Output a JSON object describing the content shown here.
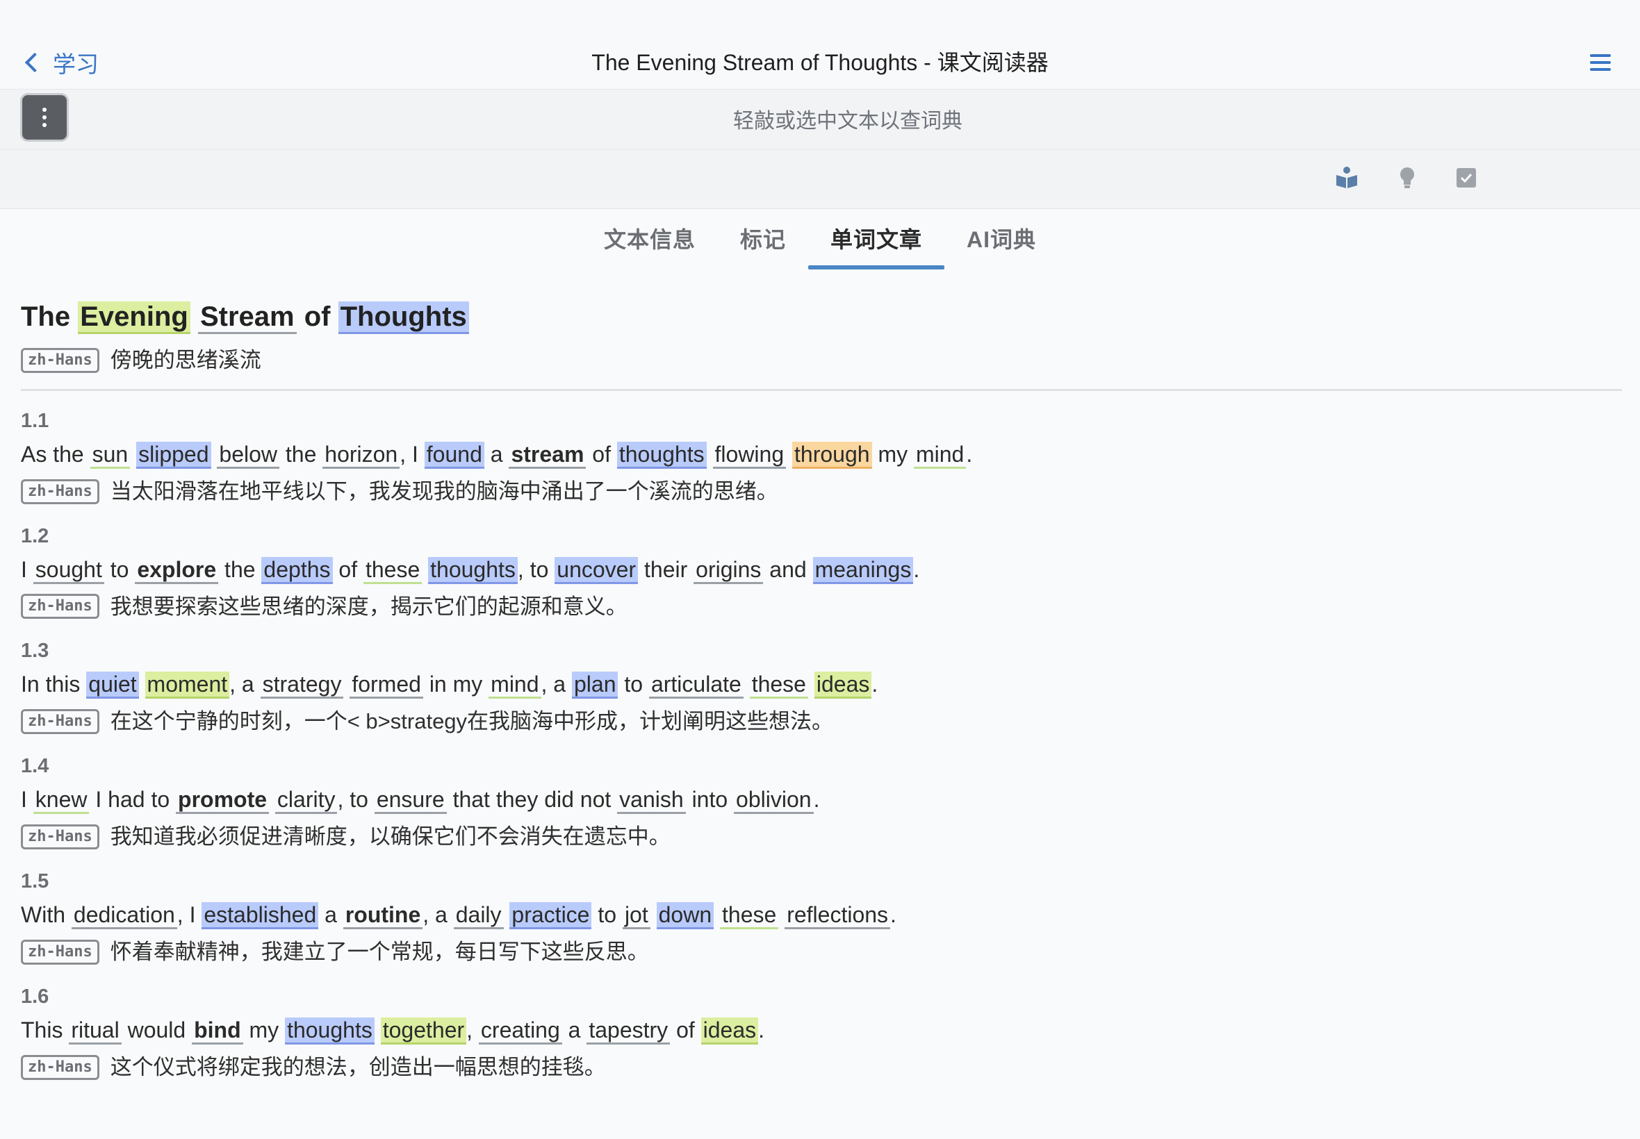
{
  "header": {
    "back_label": "学习",
    "title": "The Evening Stream of Thoughts - 课文阅读器"
  },
  "hint_bar": {
    "text": "轻敲或选中文本以查词典"
  },
  "toolbar": {
    "icons": [
      "book-reader-icon",
      "lightbulb-icon",
      "checkbox-icon"
    ]
  },
  "tabs": [
    {
      "label": "文本信息",
      "active": false
    },
    {
      "label": "标记",
      "active": false
    },
    {
      "label": "单词文章",
      "active": true
    },
    {
      "label": "AI词典",
      "active": false
    }
  ],
  "document": {
    "title_words": [
      {
        "t": "The",
        "s": "plain"
      },
      {
        "t": "Evening",
        "s": "yellow"
      },
      {
        "t": "Stream",
        "s": "line"
      },
      {
        "t": "of",
        "s": "plain"
      },
      {
        "t": "Thoughts",
        "s": "blue"
      }
    ],
    "lang_tag": "zh-Hans",
    "title_translation": "傍晚的思绪溪流",
    "sentences": [
      {
        "num": "1.1",
        "tokens": [
          {
            "t": "As",
            "s": "plain"
          },
          {
            "t": "the",
            "s": "plain"
          },
          {
            "t": "sun",
            "s": "gline"
          },
          {
            "t": "slipped",
            "s": "blue"
          },
          {
            "t": "below",
            "s": "line"
          },
          {
            "t": "the",
            "s": "plain"
          },
          {
            "t": "horizon",
            "s": "line"
          },
          {
            "t": ",",
            "s": "punct"
          },
          {
            "t": "I",
            "s": "plain"
          },
          {
            "t": "found",
            "s": "blue"
          },
          {
            "t": "a",
            "s": "plain"
          },
          {
            "t": "stream",
            "s": "bold"
          },
          {
            "t": "of",
            "s": "plain"
          },
          {
            "t": "thoughts",
            "s": "blue"
          },
          {
            "t": "flowing",
            "s": "line"
          },
          {
            "t": "through",
            "s": "orange"
          },
          {
            "t": "my",
            "s": "plain"
          },
          {
            "t": "mind",
            "s": "gline"
          },
          {
            "t": ".",
            "s": "punct"
          }
        ],
        "translation": "当太阳滑落在地平线以下，我发现我的脑海中涌出了一个溪流的思绪。"
      },
      {
        "num": "1.2",
        "tokens": [
          {
            "t": "I",
            "s": "plain"
          },
          {
            "t": "sought",
            "s": "line"
          },
          {
            "t": "to",
            "s": "plain"
          },
          {
            "t": "explore",
            "s": "bold"
          },
          {
            "t": "the",
            "s": "plain"
          },
          {
            "t": "depths",
            "s": "blue"
          },
          {
            "t": "of",
            "s": "plain"
          },
          {
            "t": "these",
            "s": "gline"
          },
          {
            "t": "thoughts",
            "s": "blue"
          },
          {
            "t": ",",
            "s": "punct"
          },
          {
            "t": "to",
            "s": "plain"
          },
          {
            "t": "uncover",
            "s": "blue"
          },
          {
            "t": "their",
            "s": "plain"
          },
          {
            "t": "origins",
            "s": "line"
          },
          {
            "t": "and",
            "s": "plain"
          },
          {
            "t": "meanings",
            "s": "blue"
          },
          {
            "t": ".",
            "s": "punct"
          }
        ],
        "translation": "我想要探索这些思绪的深度，揭示它们的起源和意义。"
      },
      {
        "num": "1.3",
        "tokens": [
          {
            "t": "In",
            "s": "plain"
          },
          {
            "t": "this",
            "s": "plain"
          },
          {
            "t": "quiet",
            "s": "blue"
          },
          {
            "t": "moment",
            "s": "yellow"
          },
          {
            "t": ",",
            "s": "punct"
          },
          {
            "t": "a",
            "s": "plain"
          },
          {
            "t": "strategy",
            "s": "line"
          },
          {
            "t": "formed",
            "s": "line"
          },
          {
            "t": "in",
            "s": "plain"
          },
          {
            "t": "my",
            "s": "plain"
          },
          {
            "t": "mind",
            "s": "gline"
          },
          {
            "t": ",",
            "s": "punct"
          },
          {
            "t": "a",
            "s": "plain"
          },
          {
            "t": "plan",
            "s": "blue"
          },
          {
            "t": "to",
            "s": "plain"
          },
          {
            "t": "articulate",
            "s": "line"
          },
          {
            "t": "these",
            "s": "gline"
          },
          {
            "t": "ideas",
            "s": "yellow"
          },
          {
            "t": ".",
            "s": "punct"
          }
        ],
        "translation": "在这个宁静的时刻，一个< b>strategy在我脑海中形成，计划阐明这些想法。"
      },
      {
        "num": "1.4",
        "tokens": [
          {
            "t": "I",
            "s": "plain"
          },
          {
            "t": "knew",
            "s": "gline"
          },
          {
            "t": "I",
            "s": "plain"
          },
          {
            "t": "had",
            "s": "plain"
          },
          {
            "t": "to",
            "s": "plain"
          },
          {
            "t": "promote",
            "s": "bold"
          },
          {
            "t": "clarity",
            "s": "line"
          },
          {
            "t": ",",
            "s": "punct"
          },
          {
            "t": "to",
            "s": "plain"
          },
          {
            "t": "ensure",
            "s": "line"
          },
          {
            "t": "that",
            "s": "plain"
          },
          {
            "t": "they",
            "s": "plain"
          },
          {
            "t": "did",
            "s": "plain"
          },
          {
            "t": "not",
            "s": "plain"
          },
          {
            "t": "vanish",
            "s": "line"
          },
          {
            "t": "into",
            "s": "plain"
          },
          {
            "t": "oblivion",
            "s": "line"
          },
          {
            "t": ".",
            "s": "punct"
          }
        ],
        "translation": "我知道我必须促进清晰度，以确保它们不会消失在遗忘中。"
      },
      {
        "num": "1.5",
        "tokens": [
          {
            "t": "With",
            "s": "plain"
          },
          {
            "t": "dedication",
            "s": "line"
          },
          {
            "t": ",",
            "s": "punct"
          },
          {
            "t": "I",
            "s": "plain"
          },
          {
            "t": "established",
            "s": "blue"
          },
          {
            "t": "a",
            "s": "plain"
          },
          {
            "t": "routine",
            "s": "bold"
          },
          {
            "t": ",",
            "s": "punct"
          },
          {
            "t": "a",
            "s": "plain"
          },
          {
            "t": "daily",
            "s": "line"
          },
          {
            "t": "practice",
            "s": "blue"
          },
          {
            "t": "to",
            "s": "plain"
          },
          {
            "t": "jot",
            "s": "line"
          },
          {
            "t": "down",
            "s": "blue"
          },
          {
            "t": "these",
            "s": "gline"
          },
          {
            "t": "reflections",
            "s": "line"
          },
          {
            "t": ".",
            "s": "punct"
          }
        ],
        "translation": "怀着奉献精神，我建立了一个常规，每日写下这些反思。"
      },
      {
        "num": "1.6",
        "tokens": [
          {
            "t": "This",
            "s": "plain"
          },
          {
            "t": "ritual",
            "s": "line"
          },
          {
            "t": "would",
            "s": "plain"
          },
          {
            "t": "bind",
            "s": "bold"
          },
          {
            "t": "my",
            "s": "plain"
          },
          {
            "t": "thoughts",
            "s": "blue"
          },
          {
            "t": "together",
            "s": "yellow"
          },
          {
            "t": ",",
            "s": "punct"
          },
          {
            "t": "creating",
            "s": "line"
          },
          {
            "t": "a",
            "s": "plain"
          },
          {
            "t": "tapestry",
            "s": "line"
          },
          {
            "t": "of",
            "s": "plain"
          },
          {
            "t": "ideas",
            "s": "yellow"
          },
          {
            "t": ".",
            "s": "punct"
          }
        ],
        "translation": "这个仪式将绑定我的想法，创造出一幅思想的挂毯。"
      }
    ]
  }
}
